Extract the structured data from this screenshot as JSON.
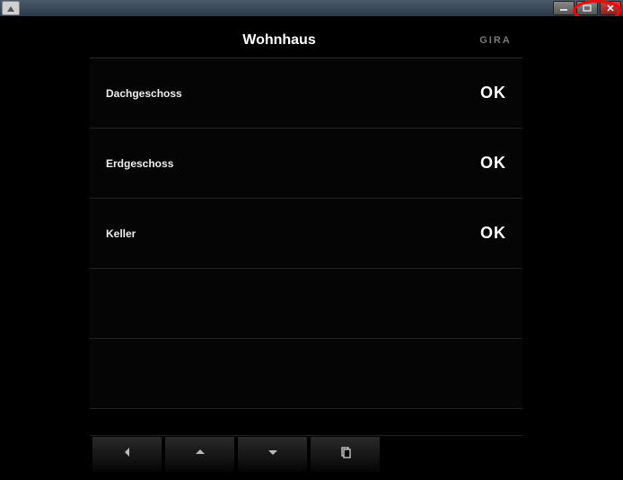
{
  "window": {
    "minimize_tooltip": "Minimize",
    "maximize_tooltip": "Maximize",
    "close_tooltip": "Close"
  },
  "header": {
    "title": "Wohnhaus",
    "brand": "GIRA"
  },
  "rows": [
    {
      "label": "Dachgeschoss",
      "status": "OK",
      "empty": false
    },
    {
      "label": "Erdgeschoss",
      "status": "OK",
      "empty": false
    },
    {
      "label": "Keller",
      "status": "OK",
      "empty": false
    },
    {
      "label": "",
      "status": "",
      "empty": true
    },
    {
      "label": "",
      "status": "",
      "empty": true
    }
  ],
  "nav": {
    "back": "Back",
    "up": "Up",
    "down": "Down",
    "copy": "Copy"
  },
  "colors": {
    "accent_annotation": "#ff0000",
    "brand_text": "#7a7a7a",
    "background": "#000000"
  }
}
